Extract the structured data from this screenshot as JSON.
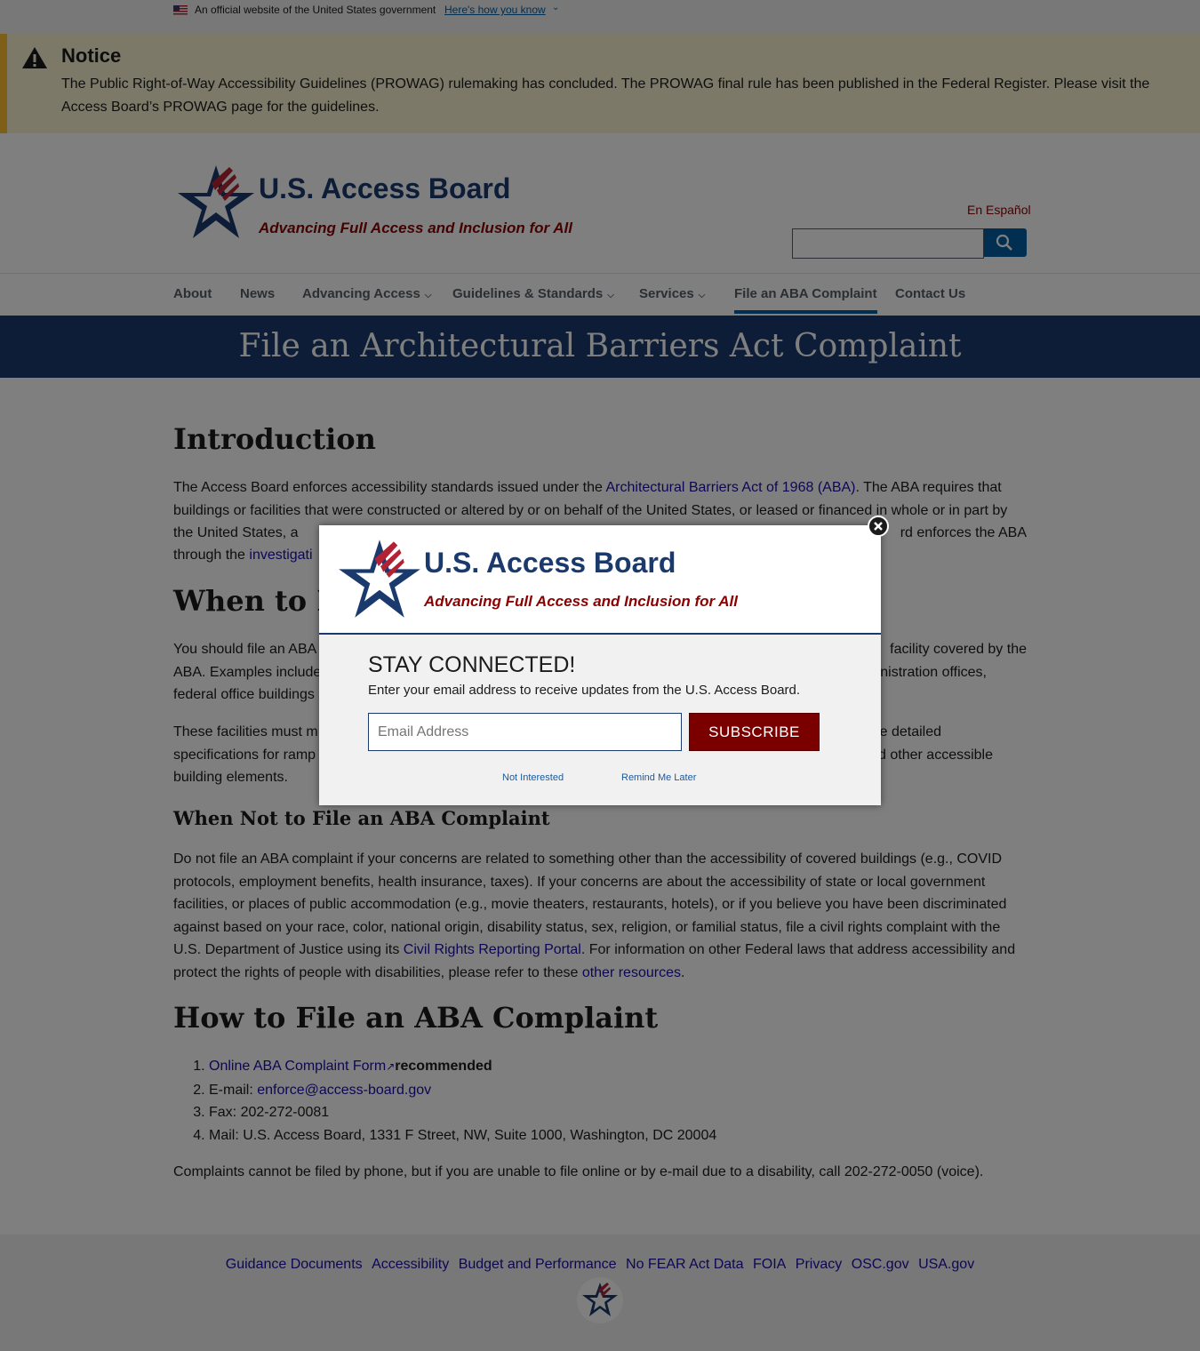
{
  "gov_banner": {
    "official_text": "An official website of the United States government",
    "how_you_know": "Here's how you know"
  },
  "notice": {
    "title": "Notice",
    "body": "The Public Right-of-Way Accessibility Guidelines (PROWAG) rulemaking has concluded. The PROWAG final rule has been published in the Federal Register. Please visit the Access Board’s PROWAG page for the guidelines."
  },
  "header": {
    "site_title": "U.S. Access Board",
    "tagline": "Advancing Full Access and Inclusion for All",
    "language_link": "En Español"
  },
  "nav": {
    "items": [
      {
        "label": "About"
      },
      {
        "label": "News"
      },
      {
        "label": "Advancing Access"
      },
      {
        "label": "Guidelines & Standards"
      },
      {
        "label": "Services"
      },
      {
        "label": "File an ABA Complaint"
      },
      {
        "label": "Contact Us"
      }
    ]
  },
  "hero": {
    "title": "File an Architectural Barriers Act Complaint"
  },
  "main": {
    "intro_heading": "Introduction",
    "intro_p1_before": "The Access Board enforces accessibility standards issued under the ",
    "intro_p1_link": "Architectural Barriers Act of 1968 (ABA)",
    "intro_p1_after": ". The ABA requires that buildings or facilities that were constructed or altered by or on behalf of the United States, or leased or financed in whole or in part by the United States, a",
    "intro_p1_right": "rd enforces the ABA",
    "intro_p1_line4_before": "through the ",
    "intro_p1_line4_link": "investigati",
    "when_heading_visible": "When to Fi",
    "when_p1_left1": "You should file an ABA c",
    "when_p1_right1": "facility covered by the",
    "when_p1_left2": "ABA. Examples include",
    "when_p1_right2": "nistration offices,",
    "when_p1_left3": "federal office buildings",
    "when_p2_left1": "These facilities must m",
    "when_p2_right1": "e detailed",
    "when_p2_left2": "specifications for ramp",
    "when_p2_right2": "d other accessible",
    "when_p2_left3": "building elements.",
    "not_heading": "When Not to File an ABA Complaint",
    "not_p_before": "Do not file an ABA complaint if your concerns are related to something other than the accessibility of covered buildings (e.g., COVID protocols, employment benefits, health insurance, taxes). If your concerns are about the accessibility of state or local government facilities, or places of public accommodation (e.g., movie theaters, restaurants, hotels), or if you believe you have been discriminated against based on your race, color, national origin, disability status, sex, religion, or familial status, file a civil rights complaint with the U.S. Department of Justice using its ",
    "not_p_link1": "Civil Rights Reporting Portal",
    "not_p_middle": ". For information on other Federal laws that address accessibility and protect the rights of people with disabilities, please refer to these ",
    "not_p_link2": "other resources",
    "not_p_end": ".",
    "how_heading": "How to File an ABA Complaint",
    "how_list": {
      "item1_link": "Online ABA Complaint Form",
      "item1_suffix": "recommended",
      "item2_prefix": "E-mail: ",
      "item2_link": "enforce@access-board.gov",
      "item3": "Fax: 202-272-0081",
      "item4": "Mail: U.S. Access Board, 1331 F Street, NW, Suite 1000, Washington, DC 20004"
    },
    "phone_note": "Complaints cannot be filed by phone, but if you are unable to file online or by e-mail due to a disability, call 202-272-0050 (voice)."
  },
  "footer": {
    "links": [
      "Guidance Documents",
      "Accessibility",
      "Budget and Performance",
      "No FEAR Act Data",
      "FOIA",
      "Privacy",
      "OSC.gov",
      "USA.gov"
    ]
  },
  "modal": {
    "title": "U.S. Access Board",
    "tagline": "Advancing Full Access and Inclusion for All",
    "heading": "STAY CONNECTED!",
    "description": "Enter your email address to receive updates from the U.S. Access Board.",
    "email_placeholder": "Email Address",
    "subscribe_label": "SUBSCRIBE",
    "not_interested": "Not Interested",
    "remind_later": "Remind Me Later"
  },
  "colors": {
    "brand_navy": "#1a3a6e",
    "brand_red": "#8b0000",
    "link_blue": "#1a0dab",
    "notice_bg": "#faf3d1",
    "notice_accent": "#ffbe2e",
    "subscribe_bg": "#7a0000"
  }
}
